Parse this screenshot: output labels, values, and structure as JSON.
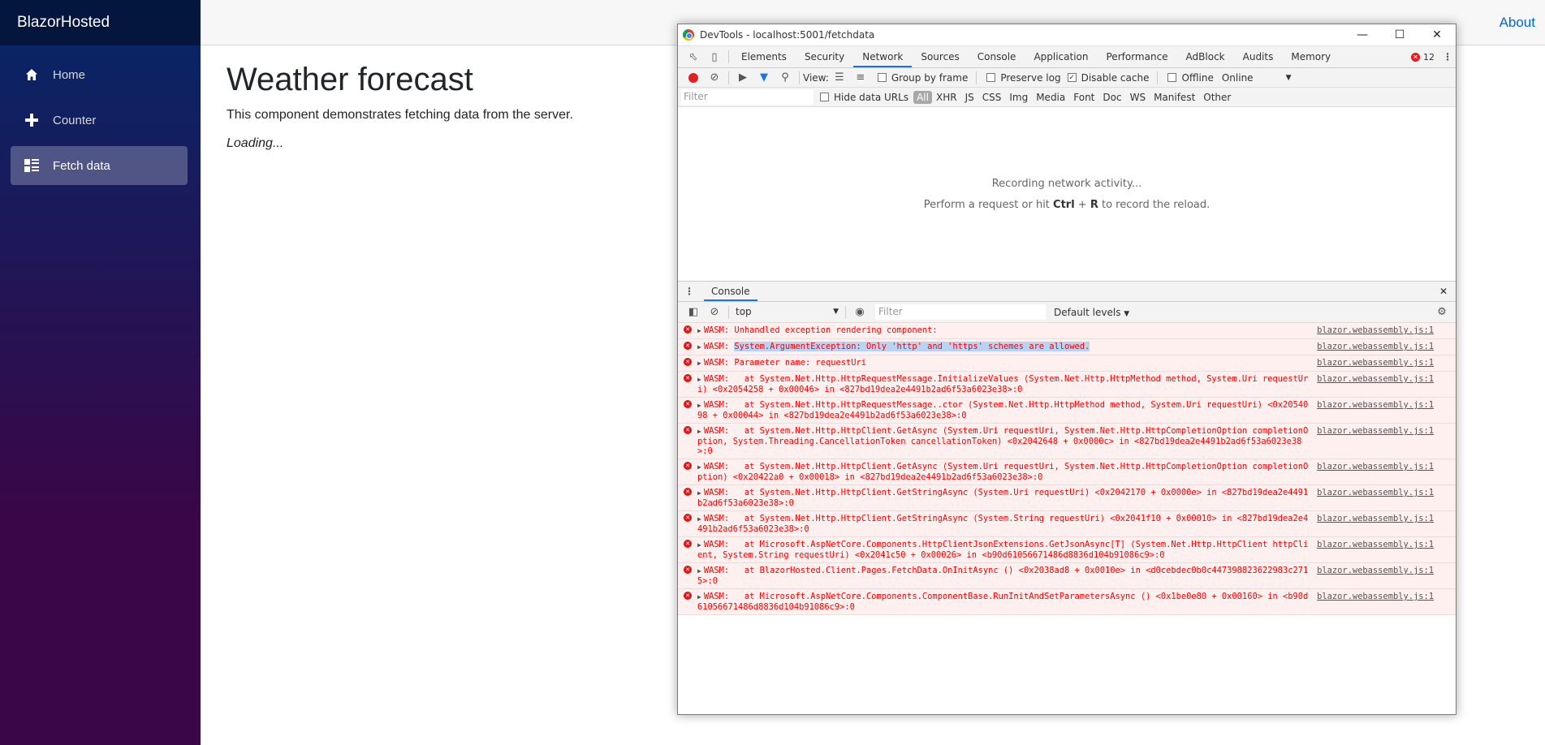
{
  "app": {
    "brand": "BlazorHosted",
    "nav": [
      {
        "label": "Home",
        "icon": "home-icon"
      },
      {
        "label": "Counter",
        "icon": "plus-icon"
      },
      {
        "label": "Fetch data",
        "icon": "list-rich-icon"
      }
    ],
    "about": "About",
    "page_title": "Weather forecast",
    "description": "This component demonstrates fetching data from the server.",
    "loading": "Loading..."
  },
  "devtools": {
    "window_title": "DevTools - localhost:5001/fetchdata",
    "tabs": [
      "Elements",
      "Security",
      "Network",
      "Sources",
      "Console",
      "Application",
      "Performance",
      "AdBlock",
      "Audits",
      "Memory"
    ],
    "error_count": "12",
    "toolbar": {
      "view": "View:",
      "group_by_frame": "Group by frame",
      "preserve_log": "Preserve log",
      "disable_cache": "Disable cache",
      "offline": "Offline",
      "throttle": "Online"
    },
    "filter": {
      "placeholder": "Filter",
      "hide_data_urls": "Hide data URLs",
      "types": [
        "All",
        "XHR",
        "JS",
        "CSS",
        "Img",
        "Media",
        "Font",
        "Doc",
        "WS",
        "Manifest",
        "Other"
      ]
    },
    "network_empty": {
      "line1": "Recording network activity...",
      "line2_pre": "Perform a request or hit ",
      "shortcut_a": "Ctrl",
      "plus": " + ",
      "shortcut_b": "R",
      "line2_post": " to record the reload."
    },
    "drawer_tab": "Console",
    "console": {
      "context": "top",
      "filter_placeholder": "Filter",
      "levels": "Default levels",
      "source": "blazor.webassembly.js:1",
      "messages": [
        {
          "pre": "WASM: ",
          "hl": "",
          "text": "Unhandled exception rendering component:"
        },
        {
          "pre": "WASM: ",
          "hl": "System.ArgumentException: Only 'http' and 'https' schemes are allowed.",
          "text": ""
        },
        {
          "pre": "WASM: ",
          "hl": "",
          "text": "Parameter name: requestUri"
        },
        {
          "pre": "WASM:   ",
          "hl": "",
          "text": "at System.Net.Http.HttpRequestMessage.InitializeValues (System.Net.Http.HttpMethod method, System.Uri requestUri) <0x2054258 + 0x00046> in <827bd19dea2e4491b2ad6f53a6023e38>:0"
        },
        {
          "pre": "WASM:   ",
          "hl": "",
          "text": "at System.Net.Http.HttpRequestMessage..ctor (System.Net.Http.HttpMethod method, System.Uri requestUri) <0x2054098 + 0x00044> in <827bd19dea2e4491b2ad6f53a6023e38>:0"
        },
        {
          "pre": "WASM:   ",
          "hl": "",
          "text": "at System.Net.Http.HttpClient.GetAsync (System.Uri requestUri, System.Net.Http.HttpCompletionOption completionOption, System.Threading.CancellationToken cancellationToken) <0x2042648 + 0x0000c> in <827bd19dea2e4491b2ad6f53a6023e38>:0"
        },
        {
          "pre": "WASM:   ",
          "hl": "",
          "text": "at System.Net.Http.HttpClient.GetAsync (System.Uri requestUri, System.Net.Http.HttpCompletionOption completionOption) <0x20422a0 + 0x00018> in <827bd19dea2e4491b2ad6f53a6023e38>:0"
        },
        {
          "pre": "WASM:   ",
          "hl": "",
          "text": "at System.Net.Http.HttpClient.GetStringAsync (System.Uri requestUri) <0x2042170 + 0x0000e> in <827bd19dea2e4491b2ad6f53a6023e38>:0"
        },
        {
          "pre": "WASM:   ",
          "hl": "",
          "text": "at System.Net.Http.HttpClient.GetStringAsync (System.String requestUri) <0x2041f10 + 0x00010> in <827bd19dea2e4491b2ad6f53a6023e38>:0"
        },
        {
          "pre": "WASM:   ",
          "hl": "",
          "text": "at Microsoft.AspNetCore.Components.HttpClientJsonExtensions.GetJsonAsync[T] (System.Net.Http.HttpClient httpClient, System.String requestUri) <0x2041c50 + 0x00026> in <b90d61056671486d8836d104b91086c9>:0"
        },
        {
          "pre": "WASM:   ",
          "hl": "",
          "text": "at BlazorHosted.Client.Pages.FetchData.OnInitAsync () <0x2038ad8 + 0x0010e> in <d0cebdec0b0c447398823622983c2715>:0"
        },
        {
          "pre": "WASM:   ",
          "hl": "",
          "text": "at Microsoft.AspNetCore.Components.ComponentBase.RunInitAndSetParametersAsync () <0x1be0e80 + 0x00160> in <b90d61056671486d8836d104b91086c9>:0"
        }
      ]
    }
  }
}
